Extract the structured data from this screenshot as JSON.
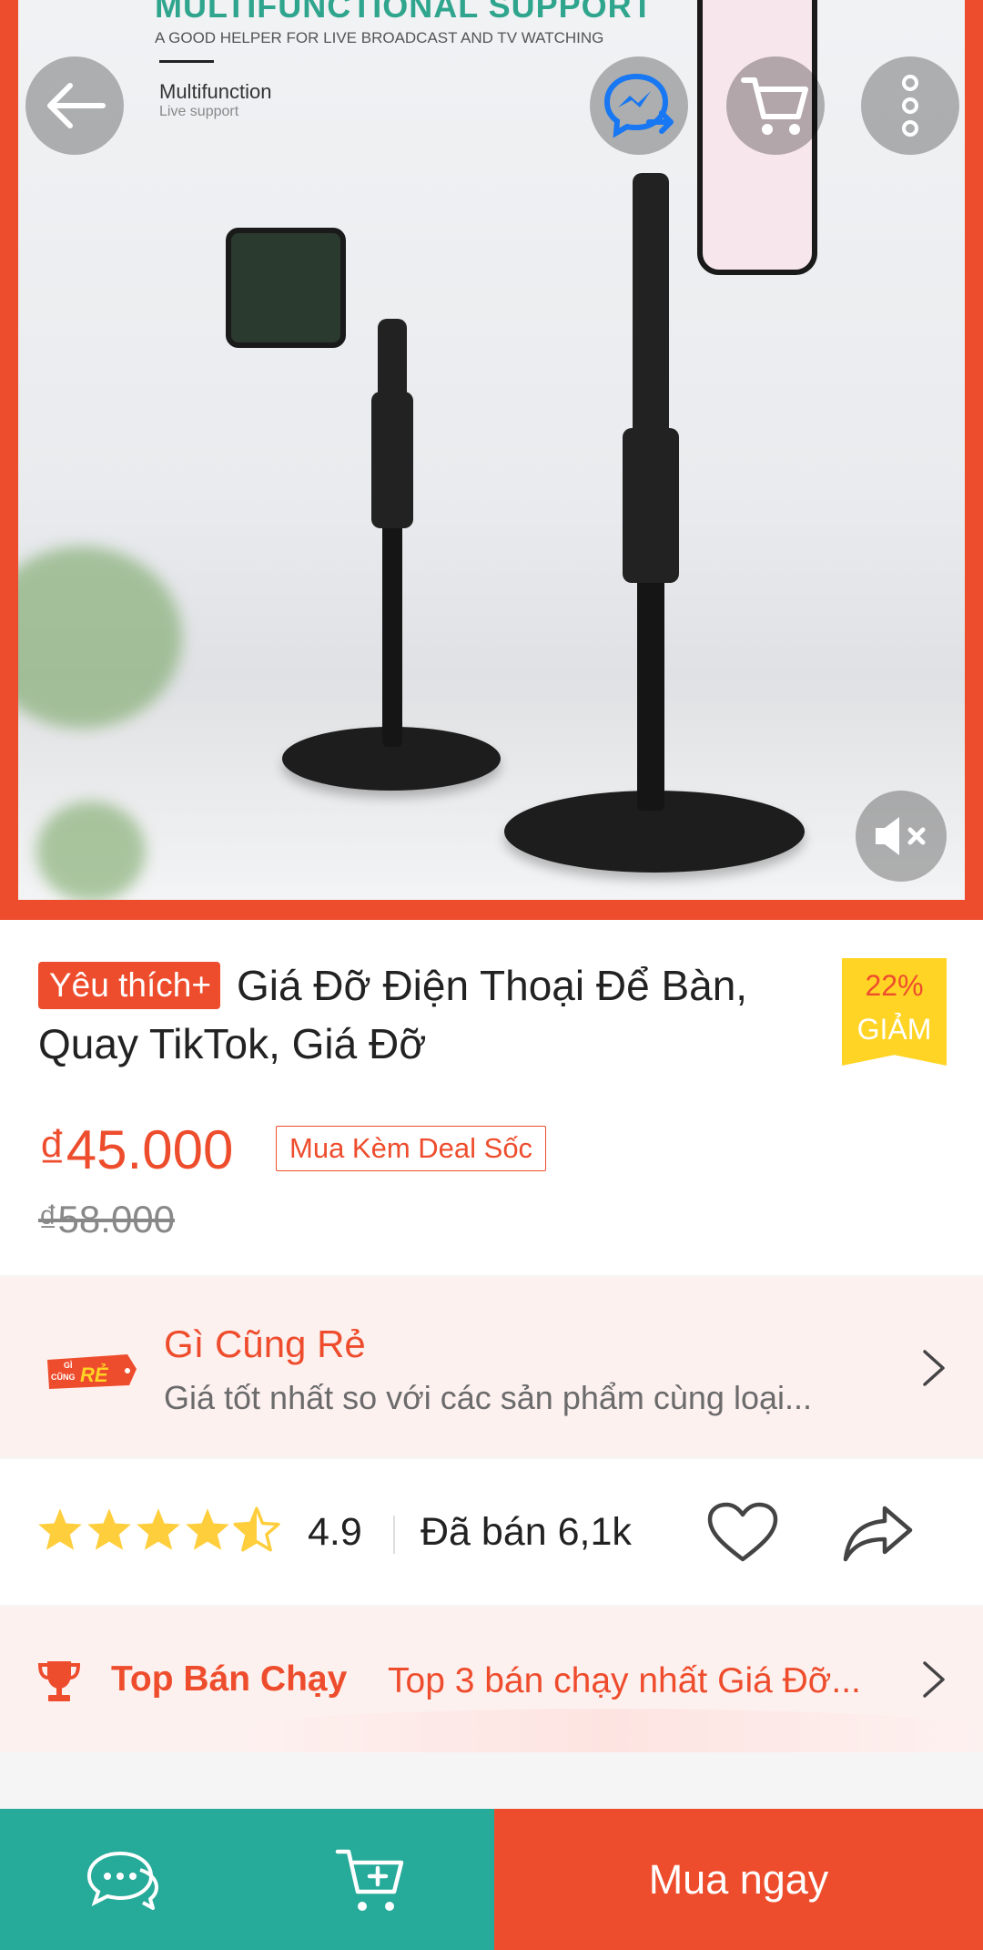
{
  "hero": {
    "banner_title": "MULTIFUNCTIONAL SUPPORT",
    "banner_subtitle": "A GOOD HELPER FOR LIVE BROADCAST AND TV WATCHING",
    "feature_title": "Multifunction",
    "feature_subtitle": "Live support",
    "icons": [
      "back-arrow-icon",
      "messenger-icon",
      "cart-icon",
      "more-vertical-icon",
      "mute-icon"
    ]
  },
  "product": {
    "badge": "Yêu thích+",
    "title": "Giá Đỡ Điện Thoại Để Bàn, Quay TikTok, Giá Đỡ",
    "discount_percent": "22%",
    "discount_label": "GIẢM",
    "price": "₫45.000",
    "deal_label": "Mua Kèm Deal Sốc",
    "original_price": "₫58.000"
  },
  "promo": {
    "logo_text_top": "GÌ",
    "logo_text_mid": "CŨNG",
    "logo_text_main": "RẺ",
    "title": "Gì Cũng Rẻ",
    "subtitle": "Giá tốt nhất so với các sản phẩm cùng loại..."
  },
  "rating": {
    "stars": 4.5,
    "value": "4.9",
    "sold": "Đã bán 6,1k"
  },
  "top_seller": {
    "label": "Top Bán Chạy",
    "description": "Top 3 bán chạy nhất Giá Đỡ..."
  },
  "bottom_bar": {
    "buy_label": "Mua ngay"
  },
  "colors": {
    "brand": "#ee4d2d",
    "teal": "#26aa99",
    "star": "#ffce3d",
    "badge_yellow": "#ffd424"
  }
}
